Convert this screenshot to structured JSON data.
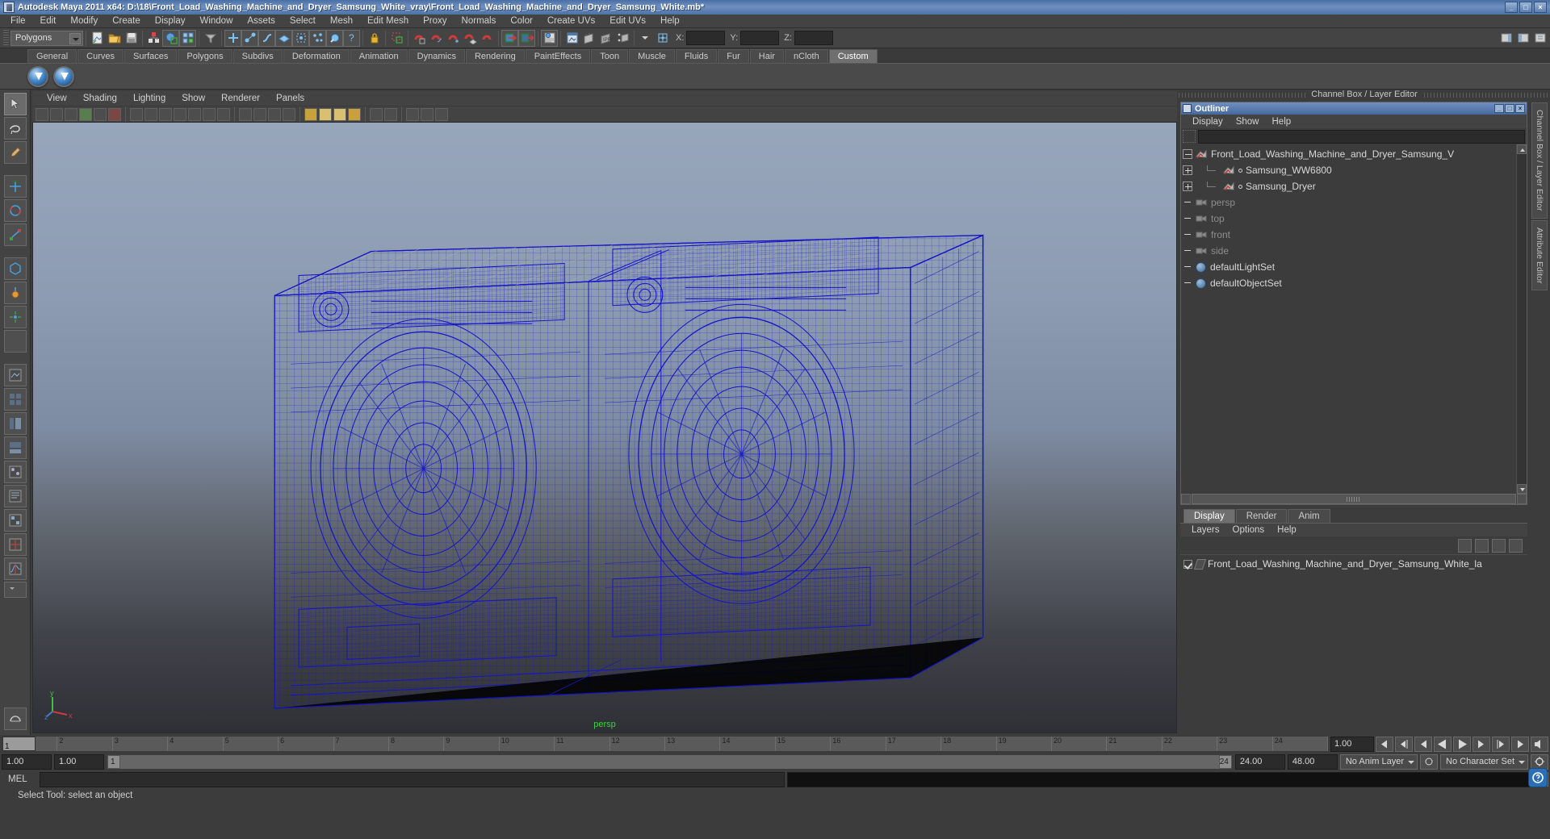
{
  "titlebar": {
    "app_title": "Autodesk Maya 2011 x64: D:\\18\\Front_Load_Washing_Machine_and_Dryer_Samsung_White_vray\\Front_Load_Washing_Machine_and_Dryer_Samsung_White.mb*",
    "minimize": "_",
    "maximize": "□",
    "close": "×",
    "accent_color": "#5f82b4"
  },
  "menubar": {
    "items": [
      "File",
      "Edit",
      "Modify",
      "Create",
      "Display",
      "Window",
      "Assets",
      "Select",
      "Mesh",
      "Edit Mesh",
      "Proxy",
      "Normals",
      "Color",
      "Create UVs",
      "Edit UVs",
      "Help"
    ]
  },
  "statusline": {
    "mode_selector": "Polygons",
    "axis_x": "X:",
    "axis_y": "Y:",
    "axis_z": "Z:",
    "x_value": "",
    "y_value": "",
    "z_value": ""
  },
  "shelf": {
    "tabs": [
      "General",
      "Curves",
      "Surfaces",
      "Polygons",
      "Subdivs",
      "Deformation",
      "Animation",
      "Dynamics",
      "Rendering",
      "PaintEffects",
      "Toon",
      "Muscle",
      "Fluids",
      "Fur",
      "Hair",
      "nCloth",
      "Custom"
    ],
    "active_tab": "Custom",
    "buttons": [
      "vray-check-icon-1",
      "vray-check-icon-2"
    ]
  },
  "viewport": {
    "menu": [
      "View",
      "Shading",
      "Lighting",
      "Show",
      "Renderer",
      "Panels"
    ],
    "camera_label": "persp",
    "axis_labels": {
      "x": "x",
      "y": "y",
      "z": "z"
    },
    "wireframe_color": "#1414c8",
    "background_top": "#97a6bb",
    "background_bottom": "#2e3036"
  },
  "right_dock": {
    "header": "Channel Box / Layer Editor",
    "vertical_tabs": [
      "Channel Box / Layer Editor",
      "Attribute Editor"
    ]
  },
  "outliner": {
    "title": "Outliner",
    "menu": [
      "Display",
      "Show",
      "Help"
    ],
    "search_value": "",
    "rows": [
      {
        "label": "Front_Load_Washing_Machine_and_Dryer_Samsung_V",
        "expander": "minus",
        "icon": "transform-icon",
        "indent": 0,
        "dim": false,
        "child": false
      },
      {
        "label": "Samsung_WW6800",
        "expander": "plus",
        "icon": "transform-icon",
        "indent": 1,
        "dim": false,
        "child": true
      },
      {
        "label": "Samsung_Dryer",
        "expander": "plus",
        "icon": "transform-icon",
        "indent": 1,
        "dim": false,
        "child": true
      },
      {
        "label": "persp",
        "expander": "none",
        "icon": "camera-icon",
        "indent": 0,
        "dim": true,
        "child": false
      },
      {
        "label": "top",
        "expander": "none",
        "icon": "camera-icon",
        "indent": 0,
        "dim": true,
        "child": false
      },
      {
        "label": "front",
        "expander": "none",
        "icon": "camera-icon",
        "indent": 0,
        "dim": true,
        "child": false
      },
      {
        "label": "side",
        "expander": "none",
        "icon": "camera-icon",
        "indent": 0,
        "dim": true,
        "child": false
      },
      {
        "label": "defaultLightSet",
        "expander": "none",
        "icon": "set-icon",
        "indent": 0,
        "dim": false,
        "child": false
      },
      {
        "label": "defaultObjectSet",
        "expander": "none",
        "icon": "set-icon",
        "indent": 0,
        "dim": false,
        "child": false
      }
    ]
  },
  "layer_editor": {
    "tabs": [
      "Display",
      "Render",
      "Anim"
    ],
    "active_tab": "Display",
    "menu": [
      "Layers",
      "Options",
      "Help"
    ],
    "layers": [
      {
        "name": "Front_Load_Washing_Machine_and_Dryer_Samsung_White_la",
        "visible": true
      }
    ]
  },
  "time_slider": {
    "ticks": [
      "1",
      "2",
      "3",
      "4",
      "5",
      "6",
      "7",
      "8",
      "9",
      "10",
      "11",
      "12",
      "13",
      "14",
      "15",
      "16",
      "17",
      "18",
      "19",
      "20",
      "21",
      "22",
      "23",
      "24"
    ],
    "current_frame": "1",
    "current_time_field": "1.00",
    "playback_buttons": [
      "go-to-start",
      "step-back-key",
      "step-back-frame",
      "play-backwards",
      "play-forwards",
      "step-forward-frame",
      "step-forward-key",
      "go-to-end",
      "sound-toggle"
    ]
  },
  "range_slider": {
    "anim_start": "1.00",
    "range_start": "1.00",
    "range_bar_start": "1",
    "range_bar_end": "24",
    "range_end": "24.00",
    "anim_end": "48.00",
    "anim_layer": "No Anim Layer",
    "character_set": "No Character Set"
  },
  "command_line": {
    "label": "MEL",
    "input_value": "",
    "output_value": ""
  },
  "help_line": {
    "message": "Select Tool: select an object"
  }
}
